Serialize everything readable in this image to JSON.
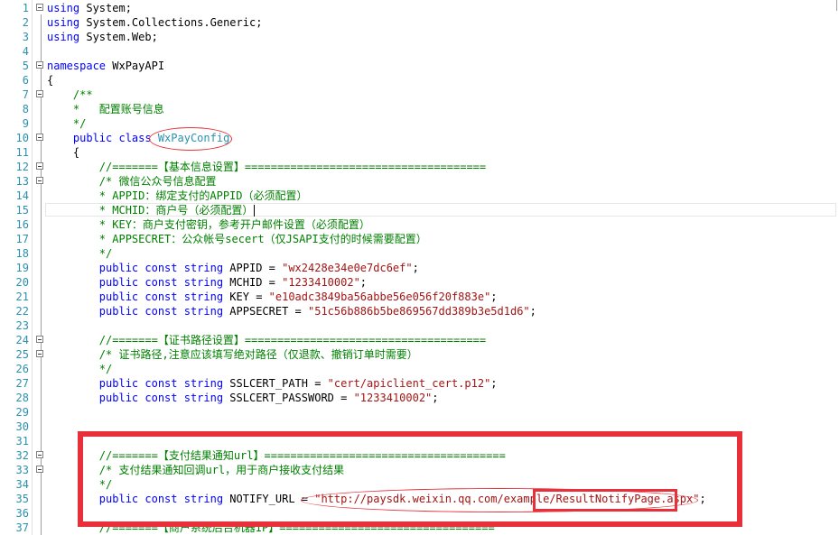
{
  "editor": {
    "lines": [
      {
        "n": "1",
        "tokens": [
          {
            "t": "using",
            "c": "kw"
          },
          {
            "t": " System;",
            "c": "pl"
          }
        ]
      },
      {
        "n": "2",
        "tokens": [
          {
            "t": "using",
            "c": "kw"
          },
          {
            "t": " System.Collections.Generic;",
            "c": "pl"
          }
        ]
      },
      {
        "n": "3",
        "tokens": [
          {
            "t": "using",
            "c": "kw"
          },
          {
            "t": " System.Web;",
            "c": "pl"
          }
        ]
      },
      {
        "n": "4",
        "tokens": []
      },
      {
        "n": "5",
        "tokens": [
          {
            "t": "namespace",
            "c": "kw"
          },
          {
            "t": " WxPayAPI",
            "c": "pl"
          }
        ]
      },
      {
        "n": "6",
        "tokens": [
          {
            "t": "{",
            "c": "pl"
          }
        ]
      },
      {
        "n": "7",
        "tokens": [
          {
            "t": "    /**",
            "c": "cm"
          }
        ]
      },
      {
        "n": "8",
        "tokens": [
          {
            "t": "    *   配置账号信息",
            "c": "cm"
          }
        ]
      },
      {
        "n": "9",
        "tokens": [
          {
            "t": "    */",
            "c": "cm"
          }
        ]
      },
      {
        "n": "10",
        "tokens": [
          {
            "t": "    public class ",
            "c": "kw"
          },
          {
            "t": "WxPayConfig",
            "c": "ty"
          }
        ]
      },
      {
        "n": "11",
        "tokens": [
          {
            "t": "    {",
            "c": "pl"
          }
        ]
      },
      {
        "n": "12",
        "tokens": [
          {
            "t": "        //=======【基本信息设置】=====================================",
            "c": "cm"
          }
        ]
      },
      {
        "n": "13",
        "tokens": [
          {
            "t": "        /* 微信公众号信息配置",
            "c": "cm"
          }
        ]
      },
      {
        "n": "14",
        "tokens": [
          {
            "t": "        * APPID：绑定支付的APPID（必须配置）",
            "c": "cm"
          }
        ]
      },
      {
        "n": "15",
        "tokens": [
          {
            "t": "        * MCHID：商户号（必须配置）",
            "c": "cm"
          }
        ]
      },
      {
        "n": "16",
        "tokens": [
          {
            "t": "        * KEY：商户支付密钥，参考开户邮件设置（必须配置）",
            "c": "cm"
          }
        ]
      },
      {
        "n": "17",
        "tokens": [
          {
            "t": "        * APPSECRET：公众帐号secert（仅JSAPI支付的时候需要配置）",
            "c": "cm"
          }
        ]
      },
      {
        "n": "18",
        "tokens": [
          {
            "t": "        */",
            "c": "cm"
          }
        ]
      },
      {
        "n": "19",
        "tokens": [
          {
            "t": "        public const string ",
            "c": "kw"
          },
          {
            "t": "APPID = ",
            "c": "pl"
          },
          {
            "t": "\"wx2428e34e0e7dc6ef\"",
            "c": "str"
          },
          {
            "t": ";",
            "c": "pl"
          }
        ]
      },
      {
        "n": "20",
        "tokens": [
          {
            "t": "        public const string ",
            "c": "kw"
          },
          {
            "t": "MCHID = ",
            "c": "pl"
          },
          {
            "t": "\"1233410002\"",
            "c": "str"
          },
          {
            "t": ";",
            "c": "pl"
          }
        ]
      },
      {
        "n": "21",
        "tokens": [
          {
            "t": "        public const string ",
            "c": "kw"
          },
          {
            "t": "KEY = ",
            "c": "pl"
          },
          {
            "t": "\"e10adc3849ba56abbe56e056f20f883e\"",
            "c": "str"
          },
          {
            "t": ";",
            "c": "pl"
          }
        ]
      },
      {
        "n": "22",
        "tokens": [
          {
            "t": "        public const string ",
            "c": "kw"
          },
          {
            "t": "APPSECRET = ",
            "c": "pl"
          },
          {
            "t": "\"51c56b886b5be869567dd389b3e5d1d6\"",
            "c": "str"
          },
          {
            "t": ";",
            "c": "pl"
          }
        ]
      },
      {
        "n": "23",
        "tokens": []
      },
      {
        "n": "24",
        "tokens": [
          {
            "t": "        //=======【证书路径设置】=====================================",
            "c": "cm"
          }
        ]
      },
      {
        "n": "25",
        "tokens": [
          {
            "t": "        /* 证书路径,注意应该填写绝对路径（仅退款、撤销订单时需要）",
            "c": "cm"
          }
        ]
      },
      {
        "n": "26",
        "tokens": [
          {
            "t": "        */",
            "c": "cm"
          }
        ]
      },
      {
        "n": "27",
        "tokens": [
          {
            "t": "        public const string ",
            "c": "kw"
          },
          {
            "t": "SSLCERT_PATH = ",
            "c": "pl"
          },
          {
            "t": "\"cert/apiclient_cert.p12\"",
            "c": "str"
          },
          {
            "t": ";",
            "c": "pl"
          }
        ]
      },
      {
        "n": "28",
        "tokens": [
          {
            "t": "        public const string ",
            "c": "kw"
          },
          {
            "t": "SSLCERT_PASSWORD = ",
            "c": "pl"
          },
          {
            "t": "\"1233410002\"",
            "c": "str"
          },
          {
            "t": ";",
            "c": "pl"
          }
        ]
      },
      {
        "n": "29",
        "tokens": []
      },
      {
        "n": "30",
        "tokens": []
      },
      {
        "n": "31",
        "tokens": []
      },
      {
        "n": "32",
        "tokens": [
          {
            "t": "        //=======【支付结果通知url】=====================================",
            "c": "cm"
          }
        ]
      },
      {
        "n": "33",
        "tokens": [
          {
            "t": "        /* 支付结果通知回调url，用于商户接收支付结果",
            "c": "cm"
          }
        ]
      },
      {
        "n": "34",
        "tokens": [
          {
            "t": "        */",
            "c": "cm"
          }
        ]
      },
      {
        "n": "35",
        "tokens": [
          {
            "t": "        public const string ",
            "c": "kw"
          },
          {
            "t": "NOTIFY_URL = ",
            "c": "pl"
          },
          {
            "t": "\"http://paysdk.weixin.qq.com/example/ResultNotifyPage.aspx\"",
            "c": "str"
          },
          {
            "t": ";",
            "c": "pl"
          }
        ]
      },
      {
        "n": "36",
        "tokens": []
      },
      {
        "n": "37",
        "tokens": [
          {
            "t": "        //=======【商户系统后台机器IP】=================================",
            "c": "cm"
          }
        ]
      }
    ],
    "fold_lines": [
      "1",
      "5",
      "7",
      "10",
      "12",
      "13",
      "24",
      "25",
      "32",
      "33"
    ],
    "colors": {
      "keyword": "#0000ff",
      "comment": "#008000",
      "string": "#a31515",
      "type": "#2b91af",
      "line_number": "#2b91af",
      "annotation": "#e8303a"
    }
  }
}
